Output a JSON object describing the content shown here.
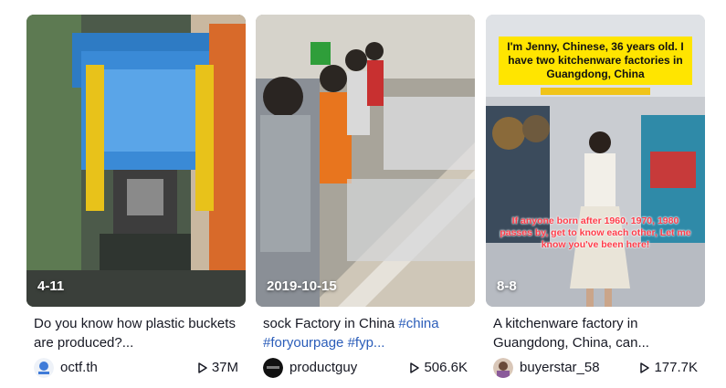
{
  "videos": [
    {
      "date": "4-11",
      "description": "Do you know how plastic buckets are produced?...",
      "tags": [],
      "author": "octf.th",
      "views": "37M"
    },
    {
      "date": "2019-10-15",
      "description": "sock Factory in China",
      "tags": [
        "#china",
        "#foryourpage",
        "#fyp..."
      ],
      "author": "productguy",
      "views": "506.6K"
    },
    {
      "date": "8-8",
      "description": "A kitchenware factory in Guangdong, China, can...",
      "tags": [],
      "author": "buyerstar_58",
      "views": "177.7K",
      "overlay_title": "I'm Jenny, Chinese, 36 years old. I have two kitchenware factories in Guangdong, China",
      "overlay_subtitle": "If anyone born after 1960, 1970, 1980 passes by, get to know each other, Let me know you've been here!"
    }
  ],
  "icons": {
    "views": "play-icon"
  },
  "colors": {
    "hashtag": "#2b5db9",
    "overlay_highlight": "#ffe500",
    "overlay_red_text": "#ff3d4a"
  }
}
